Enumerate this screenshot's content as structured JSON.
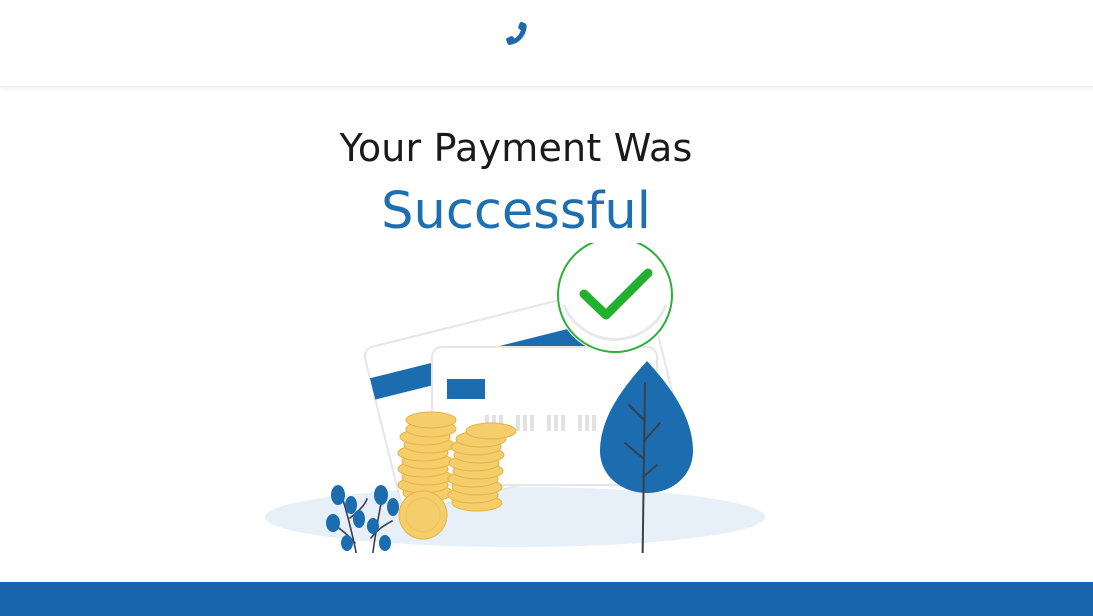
{
  "header": {
    "contact_icon": "phone-icon"
  },
  "main": {
    "title_line1": "Your Payment Was",
    "title_line2": "Successful",
    "illustration": "payment-success-illustration"
  },
  "colors": {
    "brand_blue": "#1a64ad",
    "accent_blue": "#1d6fb0",
    "success_green": "#22b02e",
    "coin_gold": "#f5cd6a",
    "ground": "#e7f0f8"
  }
}
